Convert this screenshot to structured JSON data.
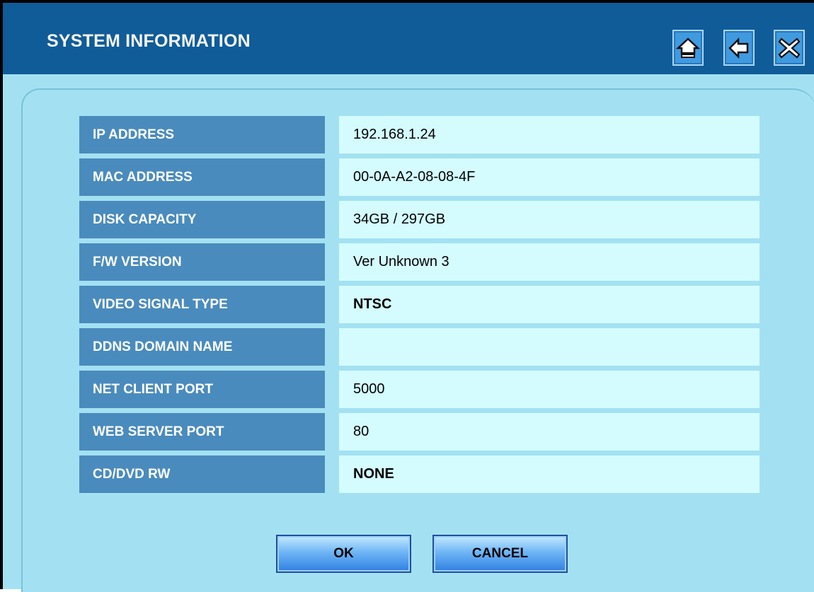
{
  "window": {
    "title": "SYSTEM INFORMATION",
    "buttons": [
      {
        "icon": "home-icon"
      },
      {
        "icon": "back-arrow-icon"
      },
      {
        "icon": "close-icon"
      }
    ]
  },
  "info": {
    "rows": [
      {
        "label": "IP ADDRESS",
        "value": "192.168.1.24"
      },
      {
        "label": "MAC ADDRESS",
        "value": "00-0A-A2-08-08-4F"
      },
      {
        "label": "DISK CAPACITY",
        "value": "34GB / 297GB"
      },
      {
        "label": "F/W VERSION",
        "value": "Ver Unknown 3"
      },
      {
        "label": "VIDEO SIGNAL TYPE",
        "value": "NTSC"
      },
      {
        "label": "DDNS DOMAIN NAME",
        "value": ""
      },
      {
        "label": "NET CLIENT PORT",
        "value": "5000"
      },
      {
        "label": "WEB SERVER PORT",
        "value": "80"
      },
      {
        "label": "CD/DVD RW",
        "value": "NONE"
      }
    ]
  },
  "actions": {
    "ok_label": "OK",
    "cancel_label": "CANCEL"
  },
  "colors": {
    "titlebar": "#0f5c99",
    "panel": "#a3e1f2",
    "label_cell": "#4a8bbd",
    "value_cell": "#d4fcff"
  }
}
